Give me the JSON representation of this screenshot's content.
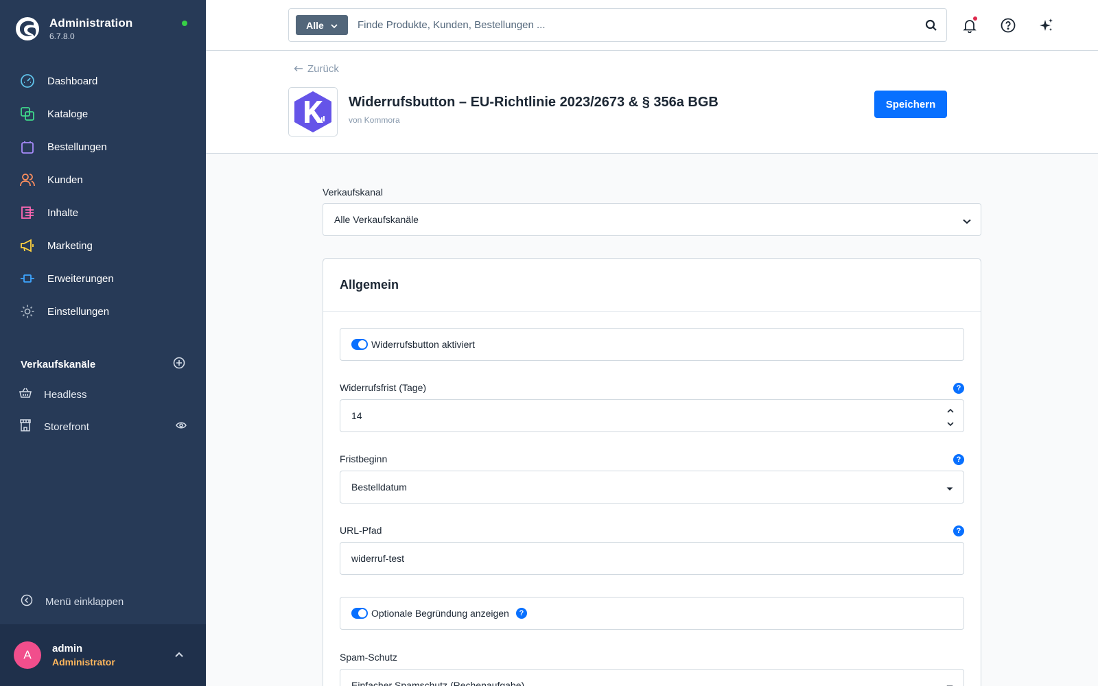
{
  "app": {
    "title": "Administration",
    "version": "6.7.8.0",
    "accent_color": "#0870ff",
    "sidebar_bg": "#273a57"
  },
  "sidebar": {
    "items": [
      {
        "label": "Dashboard",
        "icon": "gauge-icon",
        "color": "#5fc1e8"
      },
      {
        "label": "Kataloge",
        "icon": "catalog-icon",
        "color": "#3fd98b"
      },
      {
        "label": "Bestellungen",
        "icon": "shopping-bag-icon",
        "color": "#a78bfa"
      },
      {
        "label": "Kunden",
        "icon": "users-icon",
        "color": "#ff8f5e"
      },
      {
        "label": "Inhalte",
        "icon": "content-icon",
        "color": "#ff68b4"
      },
      {
        "label": "Marketing",
        "icon": "megaphone-icon",
        "color": "#ffd23f"
      },
      {
        "label": "Erweiterungen",
        "icon": "plug-icon",
        "color": "#3ea5ff"
      },
      {
        "label": "Einstellungen",
        "icon": "gear-icon",
        "color": "#a5b1bf"
      }
    ],
    "sales_channels_title": "Verkaufskanäle",
    "sales_channels": [
      {
        "label": "Headless",
        "icon": "basket-icon"
      },
      {
        "label": "Storefront",
        "icon": "storefront-icon"
      }
    ],
    "collapse_label": "Menü einklappen"
  },
  "user": {
    "initial": "A",
    "name": "admin",
    "role": "Administrator"
  },
  "search": {
    "type_label": "Alle",
    "placeholder": "Finde Produkte, Kunden, Bestellungen ..."
  },
  "header": {
    "back_label": "Zurück",
    "plugin_title": "Widerrufsbutton – EU-Richtlinie 2023/2673 & § 356a BGB",
    "plugin_vendor": "von Kommora",
    "save_label": "Speichern"
  },
  "sales_channel_field": {
    "label": "Verkaufskanal",
    "value": "Alle Verkaufskanäle"
  },
  "card": {
    "title": "Allgemein",
    "toggle_enabled": {
      "label": "Widerrufsbutton aktiviert",
      "checked": true
    },
    "period": {
      "label": "Widerrufsfrist (Tage)",
      "value": "14"
    },
    "period_start": {
      "label": "Fristbeginn",
      "value": "Bestelldatum"
    },
    "url_path": {
      "label": "URL-Pfad",
      "value": "widerruf-test"
    },
    "toggle_reason": {
      "label": "Optionale Begründung anzeigen",
      "checked": true
    },
    "spam": {
      "label": "Spam-Schutz",
      "value": "Einfacher Spamschutz (Rechenaufgabe)"
    },
    "help_symbol": "?"
  }
}
